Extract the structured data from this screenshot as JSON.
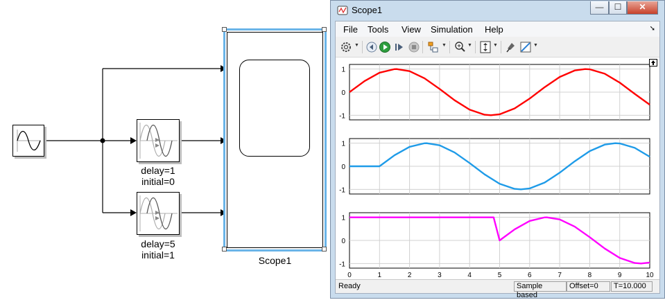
{
  "model": {
    "delay_block_1": {
      "line1": "delay=1",
      "line2": "initial=0"
    },
    "delay_block_2": {
      "line1": "delay=5",
      "line2": "initial=1"
    },
    "scope_block_name": "Scope1"
  },
  "scope_window": {
    "title": "Scope1",
    "buttons": {
      "minimize": "—",
      "maximize": "☐",
      "close": "✕"
    },
    "menu": [
      "File",
      "Tools",
      "View",
      "Simulation",
      "Help"
    ],
    "status": {
      "ready": "Ready",
      "sample_based": "Sample based",
      "offset": "Offset=0",
      "time": "T=10.000"
    }
  },
  "colors": {
    "series1": "#ff0000",
    "series2": "#1e9be8",
    "series3": "#ff00ff",
    "selection": "#6ab4e8"
  },
  "icons": [
    "sine-wave-icon",
    "variable-delay-icon",
    "scope-icon",
    "gear-icon",
    "step-back-icon",
    "run-icon",
    "step-forward-icon",
    "stop-icon",
    "highlight-block-icon",
    "zoom-icon",
    "autoscale-icon",
    "pin-icon",
    "style-icon",
    "undock-icon"
  ],
  "chart_data": [
    {
      "type": "line",
      "xlim": [
        0,
        10
      ],
      "ylim": [
        -1.2,
        1.2
      ],
      "yticks": [
        "-1",
        "0",
        "1"
      ],
      "xticks": [],
      "grid": true,
      "series": [
        {
          "color": "#ff0000",
          "x": [
            0,
            0.5,
            1,
            1.5,
            1.57,
            2,
            2.5,
            3,
            3.5,
            4,
            4.5,
            4.71,
            5,
            5.5,
            6,
            6.5,
            7,
            7.5,
            7.85,
            8,
            8.5,
            9,
            9.5,
            10
          ],
          "y": [
            0,
            0.479,
            0.841,
            0.997,
            1,
            0.909,
            0.598,
            0.141,
            -0.351,
            -0.757,
            -0.978,
            -1,
            -0.959,
            -0.706,
            -0.279,
            0.215,
            0.657,
            0.938,
            1,
            0.989,
            0.798,
            0.412,
            -0.075,
            -0.544
          ]
        }
      ]
    },
    {
      "type": "line",
      "xlim": [
        0,
        10
      ],
      "ylim": [
        -1.2,
        1.2
      ],
      "yticks": [
        "-1",
        "0",
        "1"
      ],
      "xticks": [],
      "grid": true,
      "series": [
        {
          "color": "#1e9be8",
          "x": [
            0,
            1,
            1.5,
            2,
            2.5,
            2.57,
            3,
            3.5,
            4,
            4.5,
            5,
            5.5,
            5.71,
            6,
            6.5,
            7,
            7.5,
            8,
            8.5,
            8.85,
            9,
            9.5,
            10
          ],
          "y": [
            0,
            0,
            0.479,
            0.841,
            0.997,
            1,
            0.909,
            0.598,
            0.141,
            -0.351,
            -0.757,
            -0.978,
            -1,
            -0.959,
            -0.706,
            -0.279,
            0.215,
            0.657,
            0.938,
            1,
            0.989,
            0.798,
            0.412
          ]
        }
      ]
    },
    {
      "type": "line",
      "xlim": [
        0,
        10
      ],
      "ylim": [
        -1.2,
        1.2
      ],
      "yticks": [
        "-1",
        "0",
        "1"
      ],
      "xticks": [
        "0",
        "1",
        "2",
        "3",
        "4",
        "5",
        "6",
        "7",
        "8",
        "9",
        "10"
      ],
      "grid": true,
      "series": [
        {
          "color": "#ff00ff",
          "x": [
            0,
            4.8,
            5,
            5.5,
            6,
            6.5,
            6.57,
            7,
            7.5,
            8,
            8.5,
            9,
            9.5,
            9.71,
            10
          ],
          "y": [
            1,
            1,
            0,
            0.479,
            0.841,
            0.997,
            1,
            0.909,
            0.598,
            0.141,
            -0.351,
            -0.757,
            -0.978,
            -1,
            -0.959
          ]
        }
      ]
    }
  ]
}
